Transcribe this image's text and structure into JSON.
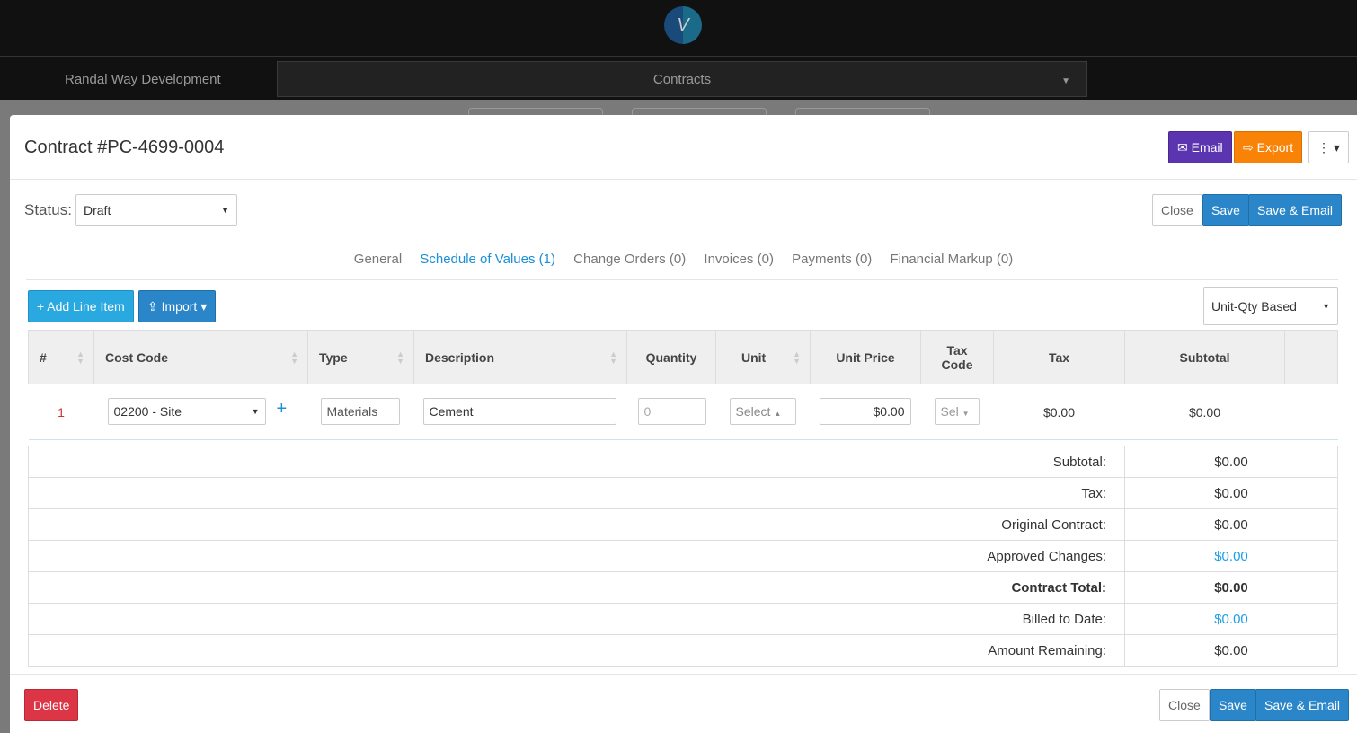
{
  "header": {
    "logo": "V",
    "project": "Randal Way Development",
    "module": "Contracts"
  },
  "modal": {
    "title": "Contract #PC-4699-0004",
    "email": "Email",
    "export": "Export",
    "status_label": "Status:",
    "status": "Draft",
    "close": "Close",
    "save": "Save",
    "save_email": "Save & Email",
    "delete": "Delete",
    "tabs": [
      "General",
      "Schedule of Values (1)",
      "Change Orders (0)",
      "Invoices (0)",
      "Payments (0)",
      "Financial Markup (0)"
    ],
    "add_line": "+ Add Line Item",
    "import": "Import",
    "mode": "Unit-Qty Based",
    "columns": [
      "#",
      "Cost Code",
      "Type",
      "Description",
      "Quantity",
      "Unit",
      "Unit Price",
      "Tax Code",
      "Tax",
      "Subtotal"
    ],
    "row": {
      "num": "1",
      "cost_code": "02200 - Site",
      "type": "Materials",
      "description": "Cement",
      "quantity_placeholder": "0",
      "unit": "Select",
      "unit_price": "$0.00",
      "tax_code": "Sel",
      "tax": "$0.00",
      "subtotal": "$0.00"
    },
    "totals": [
      {
        "label": "Subtotal:",
        "value": "$0.00"
      },
      {
        "label": "Tax:",
        "value": "$0.00"
      },
      {
        "label": "Original Contract:",
        "value": "$0.00"
      },
      {
        "label": "Approved Changes:",
        "value": "$0.00"
      },
      {
        "label": "Contract Total:",
        "value": "$0.00"
      },
      {
        "label": "Billed to Date:",
        "value": "$0.00"
      },
      {
        "label": "Amount Remaining:",
        "value": "$0.00"
      }
    ]
  },
  "colors": {
    "email": "#5b34b0",
    "export": "#f98307",
    "primary": "#2a86c8",
    "danger": "#dc3545"
  }
}
